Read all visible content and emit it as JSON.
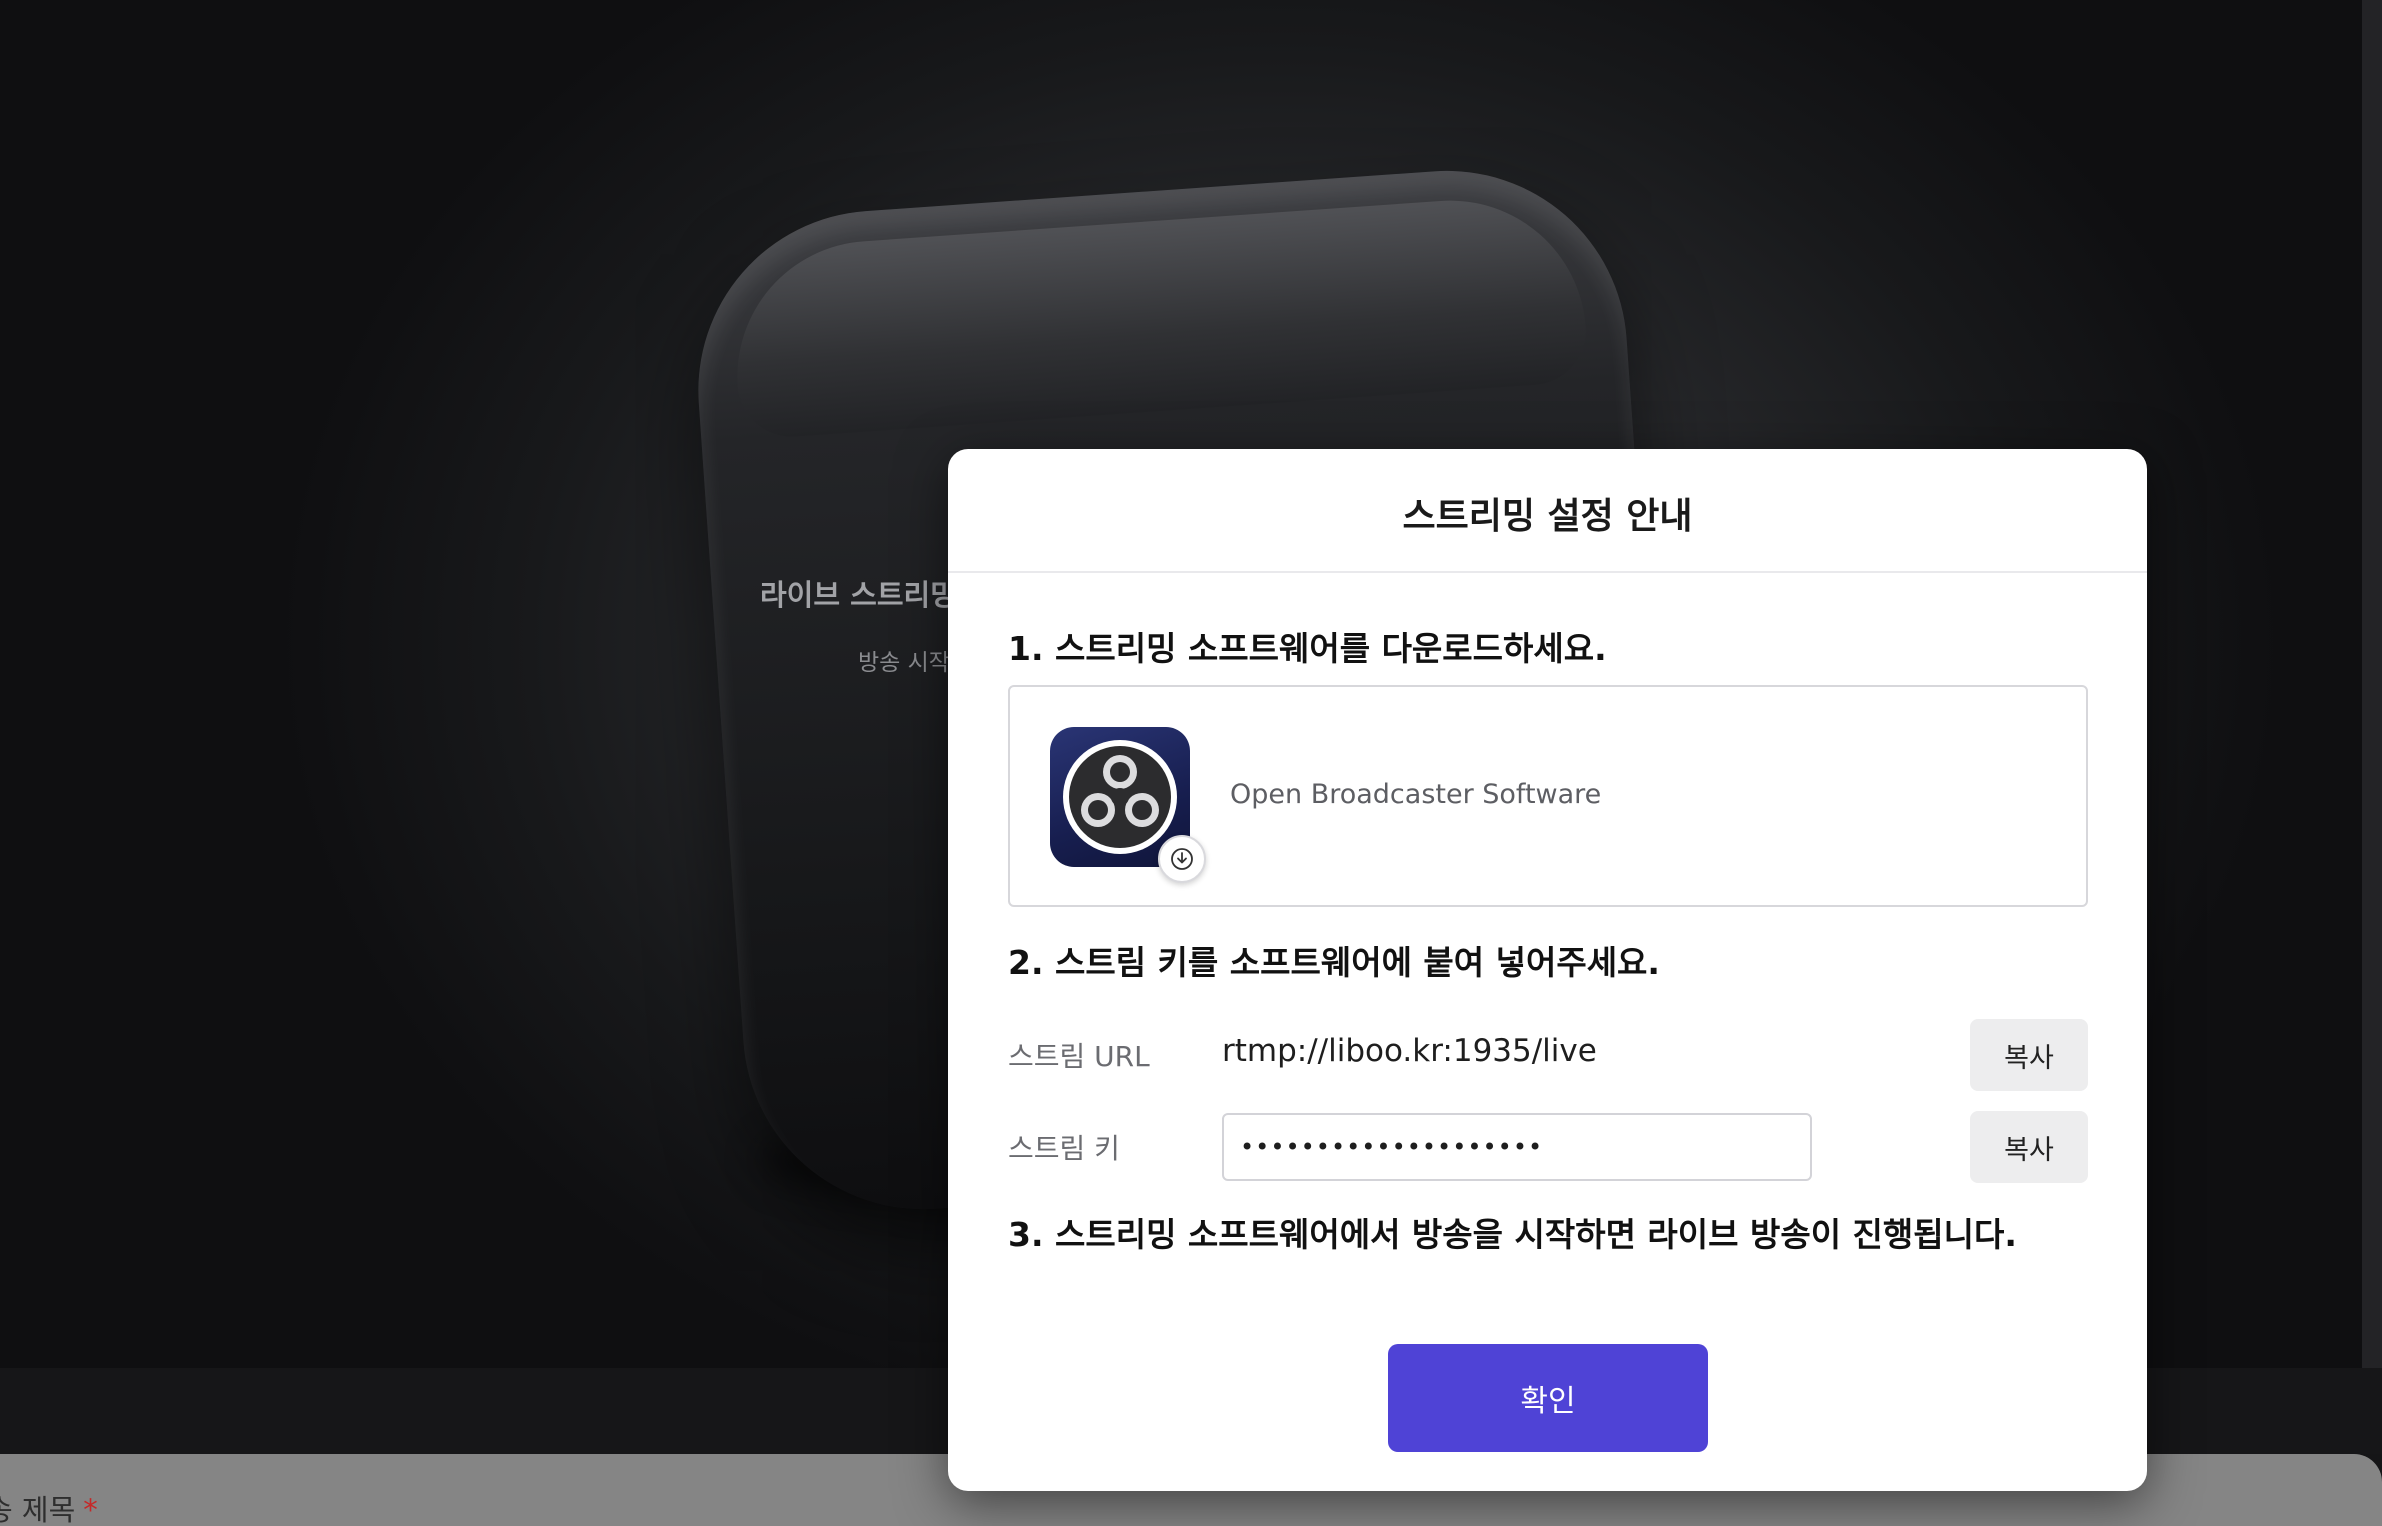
{
  "background": {
    "title": "라이브 스트리밍",
    "subtitle": "방송 시작",
    "form_label": "송 제목",
    "required_mark": "*"
  },
  "modal": {
    "title": "스트리밍 설정 안내",
    "step1": "1. 스트리밍 소프트웨어를 다운로드하세요.",
    "software": {
      "name": "Open Broadcaster Software",
      "icon": "obs-logo-icon",
      "badge_icon": "download-icon"
    },
    "step2": "2. 스트림 키를 소프트웨어에 붙여 넣어주세요.",
    "stream_url_label": "스트림 URL",
    "stream_url_value": "rtmp://liboo.kr:1935/live",
    "stream_key_label": "스트림 키",
    "stream_key_value": "••••••••••••••••••••",
    "copy_label": "복사",
    "step3": "3. 스트리밍 소프트웨어에서 방송을 시작하면 라이브 방송이 진행됩니다.",
    "confirm_label": "확인"
  },
  "colors": {
    "accent": "#4f43d6",
    "required": "#c62828"
  }
}
